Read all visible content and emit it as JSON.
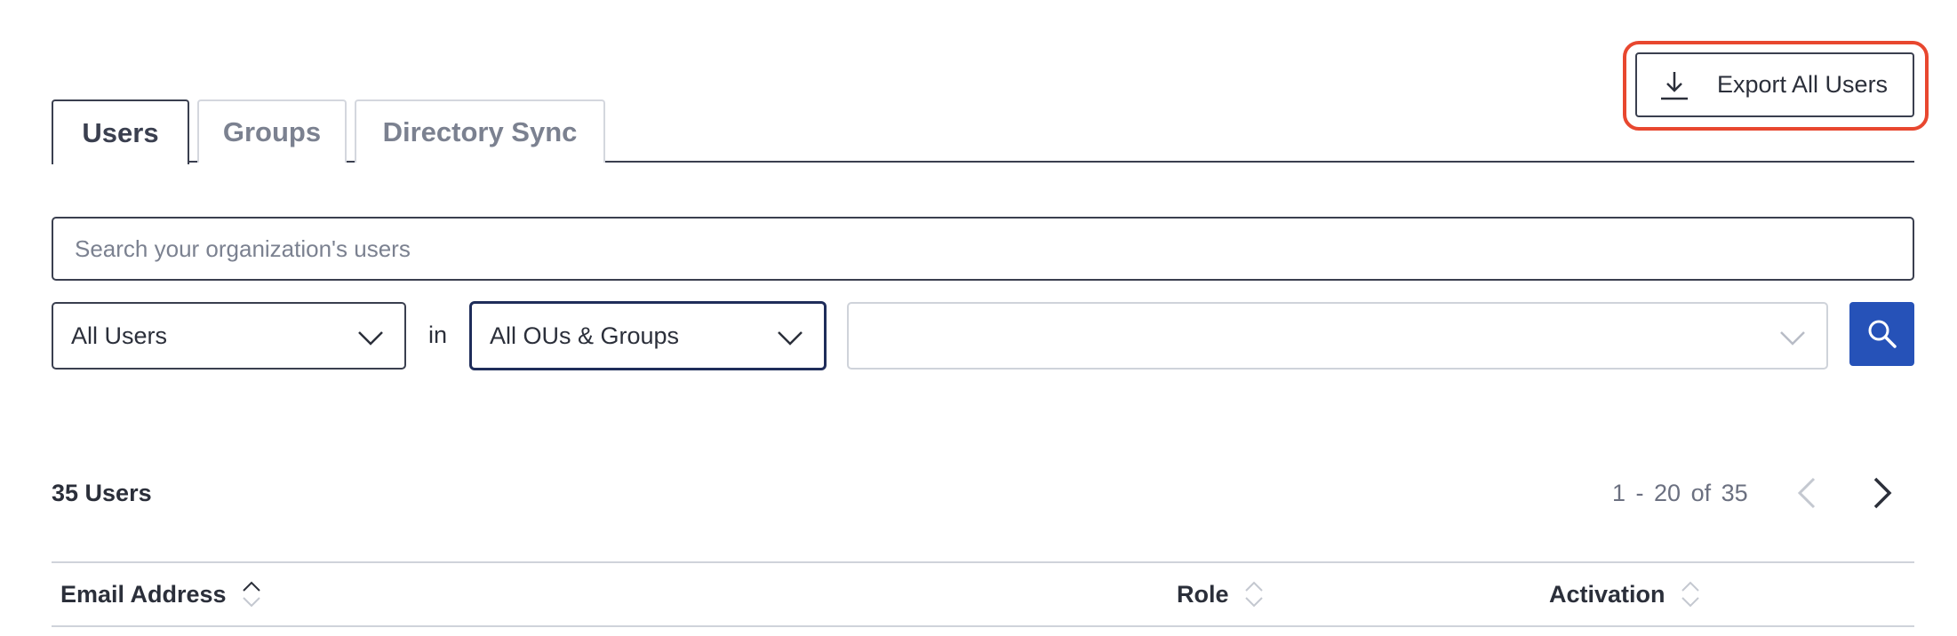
{
  "tabs": [
    {
      "label": "Users",
      "active": true
    },
    {
      "label": "Groups",
      "active": false
    },
    {
      "label": "Directory Sync",
      "active": false
    }
  ],
  "export": {
    "label": "Export All Users",
    "icon": "download-icon"
  },
  "search": {
    "placeholder": "Search your organization's users"
  },
  "filters": {
    "user_type": "All Users",
    "connector": "in",
    "scope": "All OUs & Groups",
    "third": ""
  },
  "results": {
    "count_label": "35 Users",
    "range": "1 - 20",
    "of_label": "of",
    "total": "35"
  },
  "table": {
    "columns": [
      {
        "label": "Email Address",
        "sortable": true
      },
      {
        "label": "Role",
        "sortable": true
      },
      {
        "label": "Activation",
        "sortable": true
      }
    ]
  },
  "colors": {
    "primary_button": "#2652b8",
    "highlight": "#e8472f",
    "border_dark": "#3a3f4f"
  }
}
